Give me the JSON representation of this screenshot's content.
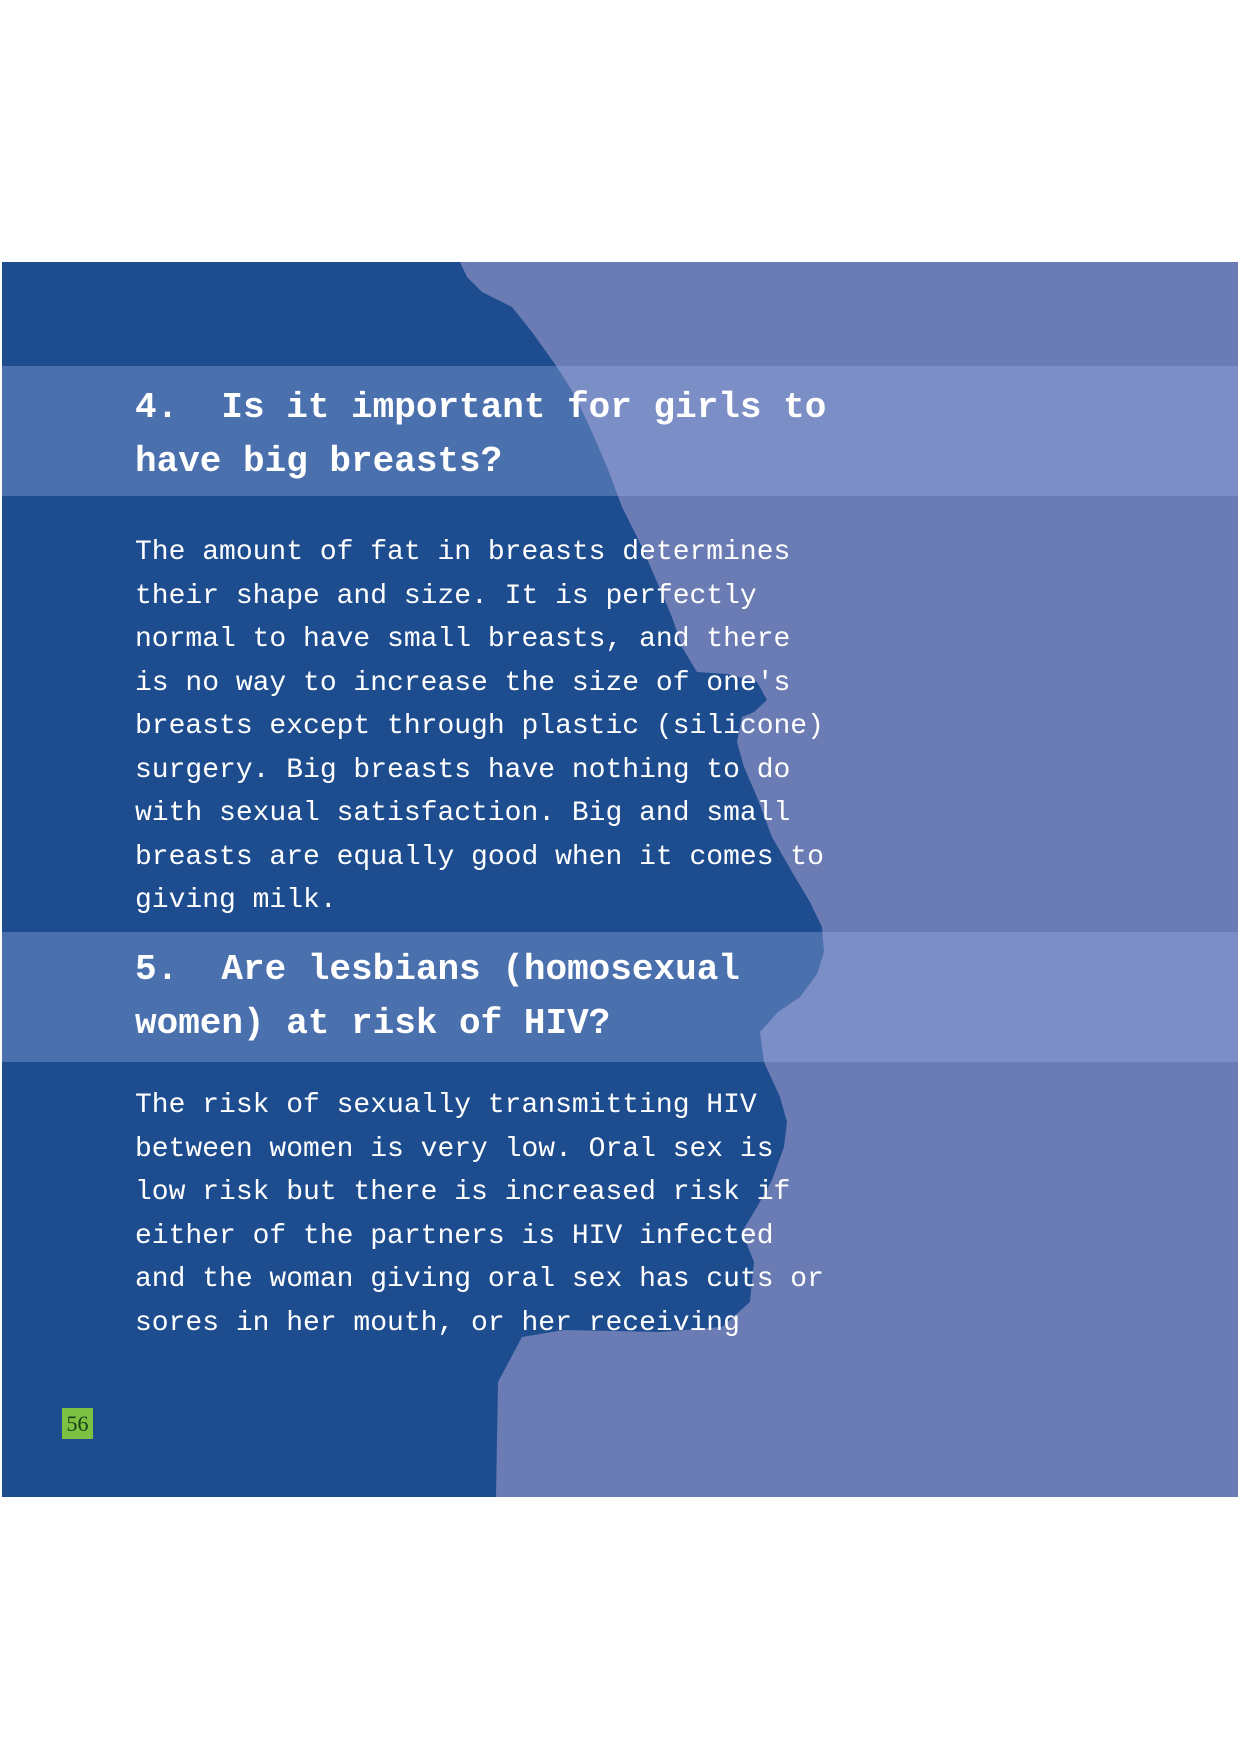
{
  "colors": {
    "panel_dark_blue": "#1e4d8f",
    "silhouette_light_blue": "#6b7cb4",
    "heading_band": "#8a9bd0",
    "page_number_green": "#7cc142"
  },
  "sections": [
    {
      "heading": "4.  Is it important for girls to\nhave big breasts?",
      "body": "The amount of fat in breasts determines\ntheir shape and size. It is perfectly\nnormal to have small breasts, and there\nis no way to increase the size of one's\nbreasts except through plastic (silicone)\nsurgery. Big breasts have nothing to do\nwith sexual satisfaction. Big and small\nbreasts are equally good when it comes to\ngiving milk."
    },
    {
      "heading": "5.  Are lesbians (homosexual\nwomen) at risk of HIV?",
      "body": "The risk of sexually transmitting HIV\nbetween women is very low. Oral sex is\nlow risk but there is increased risk if\neither of the partners is HIV infected\nand the woman giving oral sex has cuts or\nsores in her mouth, or her receiving"
    }
  ],
  "page_number": "56"
}
